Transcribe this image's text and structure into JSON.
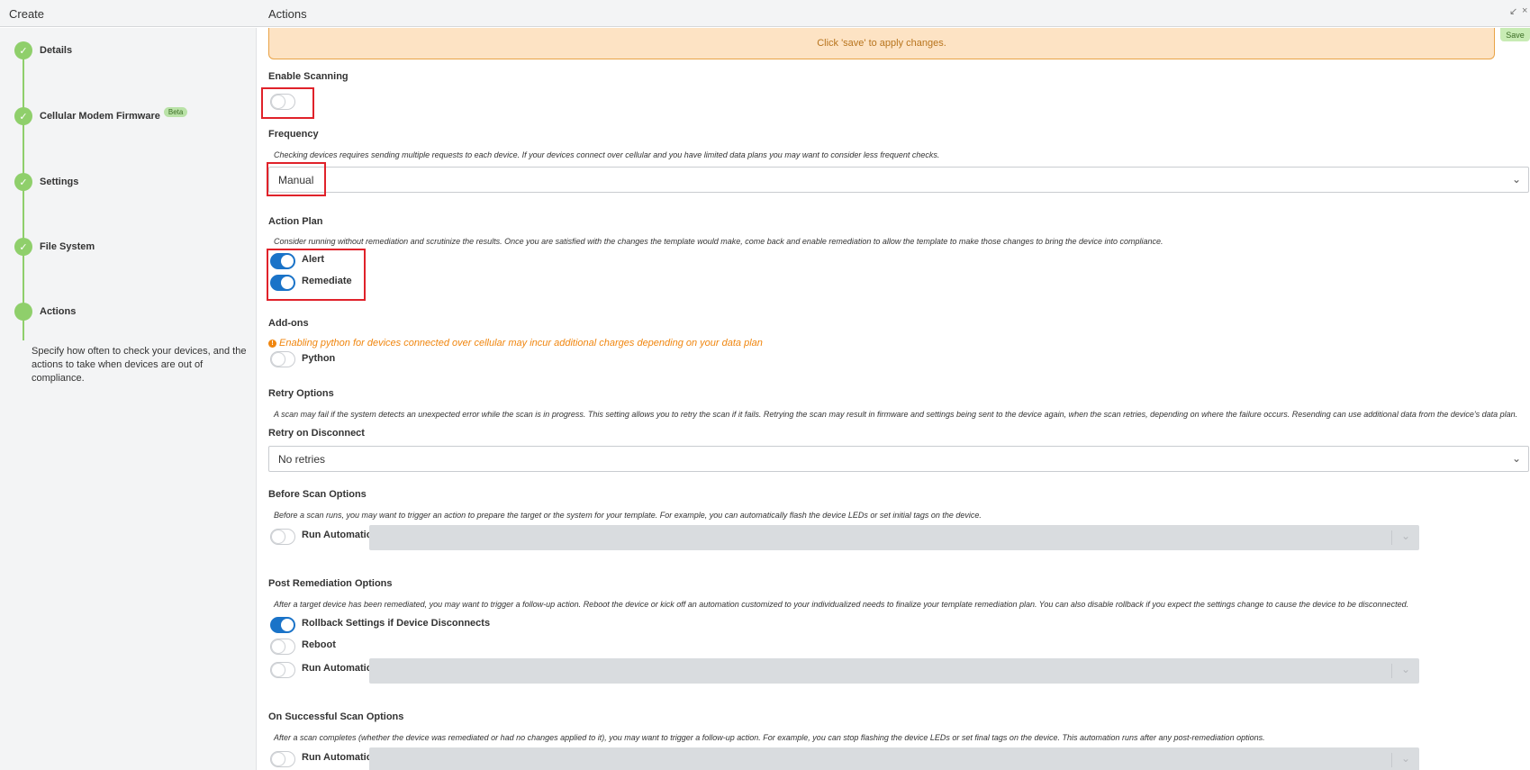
{
  "header": {
    "left_title": "Create",
    "right_title": "Actions",
    "icons": [
      "collapse-icon",
      "close-icon"
    ]
  },
  "sidebar": {
    "steps": [
      {
        "label": "Details",
        "icon": "check-icon"
      },
      {
        "label": "Cellular Modem Firmware",
        "badge": "Beta",
        "icon": "check-icon"
      },
      {
        "label": "Settings",
        "icon": "check-icon"
      },
      {
        "label": "File System",
        "icon": "check-icon"
      },
      {
        "label": "Actions"
      }
    ],
    "description": "Specify how often to check your devices, and the actions to take when devices are out of compliance."
  },
  "main": {
    "notice": "Click 'save' to apply changes.",
    "save_label": "Save",
    "enable_scanning": {
      "title": "Enable Scanning",
      "enabled": false
    },
    "frequency": {
      "title": "Frequency",
      "help": "Checking devices requires sending multiple requests to each device. If your devices connect over cellular and you have limited data plans you may want to consider less frequent checks.",
      "value": "Manual"
    },
    "action_plan": {
      "title": "Action Plan",
      "help": "Consider running without remediation and scrutinize the results. Once you are satisfied with the changes the template would make, come back and enable remediation to allow the template to make those changes to bring the device into compliance.",
      "options": [
        {
          "label": "Alert",
          "enabled": true
        },
        {
          "label": "Remediate",
          "enabled": true
        }
      ]
    },
    "addons": {
      "title": "Add-ons",
      "warning": "Enabling python for devices connected over cellular may incur additional charges depending on your data plan",
      "python": {
        "label": "Python",
        "enabled": false
      }
    },
    "retry": {
      "title": "Retry Options",
      "help": "A scan may fail if the system detects an unexpected error while the scan is in progress. This setting allows you to retry the scan if it fails. Retrying the scan may result in firmware and settings being sent to the device again, when the scan retries, depending on where the failure occurs. Resending can use additional data from the device's data plan.",
      "subtitle": "Retry on Disconnect",
      "value": "No retries"
    },
    "before_scan": {
      "title": "Before Scan Options",
      "help": "Before a scan runs, you may want to trigger an action to prepare the target or the system for your template. For example, you can automatically flash the device LEDs or set initial tags on the device.",
      "run_automation": {
        "label": "Run Automation",
        "enabled": false
      }
    },
    "post_remediation": {
      "title": "Post Remediation Options",
      "help": "After a target device has been remediated, you may want to trigger a follow-up action. Reboot the device or kick off an automation customized to your individualized needs to finalize your template remediation plan. You can also disable rollback if you expect the settings change to cause the device to be disconnected.",
      "rollback": {
        "label": "Rollback Settings if Device Disconnects",
        "enabled": true
      },
      "reboot": {
        "label": "Reboot",
        "enabled": false
      },
      "run_automation": {
        "label": "Run Automation",
        "enabled": false
      }
    },
    "on_success": {
      "title": "On Successful Scan Options",
      "help": "After a scan completes (whether the device was remediated or had no changes applied to it), you may want to trigger a follow-up action. For example, you can stop flashing the device LEDs or set final tags on the device. This automation runs after any post-remediation options.",
      "run_automation": {
        "label": "Run Automation",
        "enabled": false
      }
    }
  },
  "colors": {
    "accent": "#1a73c8",
    "step_green": "#8fcf6b",
    "notice_bg": "#fde3c4",
    "warning": "#f0860f",
    "highlight": "#e0222a"
  }
}
